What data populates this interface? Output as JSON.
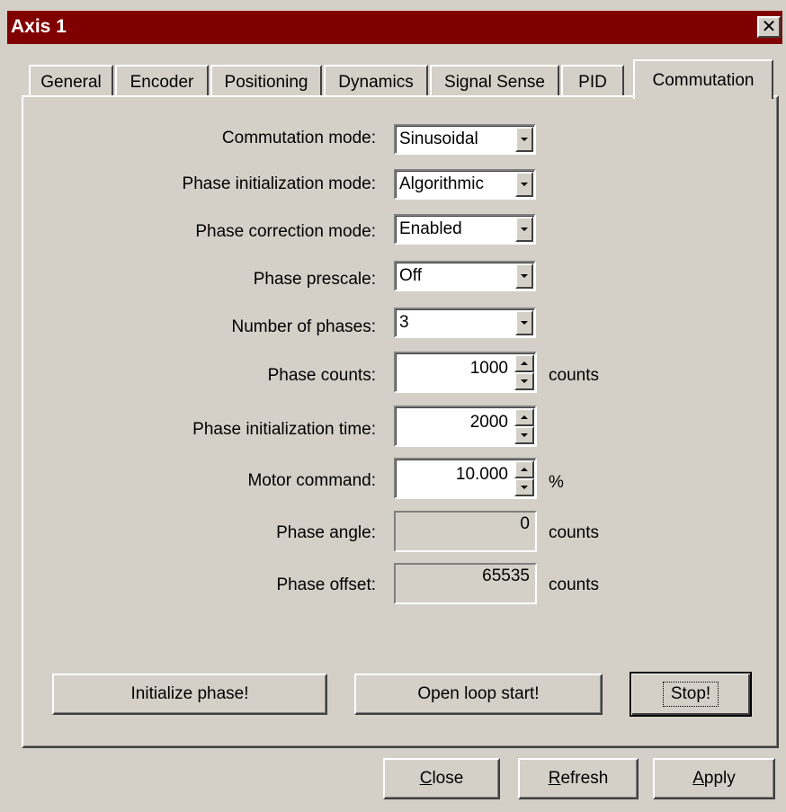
{
  "window": {
    "title": "Axis 1"
  },
  "tabs": [
    {
      "label": "General"
    },
    {
      "label": "Encoder"
    },
    {
      "label": "Positioning"
    },
    {
      "label": "Dynamics"
    },
    {
      "label": "Signal Sense"
    },
    {
      "label": "PID"
    },
    {
      "label": "Commutation",
      "active": true
    }
  ],
  "form": {
    "commutation_mode": {
      "label": "Commutation mode:",
      "value": "Sinusoidal"
    },
    "phase_init_mode": {
      "label": "Phase initialization mode:",
      "value": "Algorithmic"
    },
    "phase_correction_mode": {
      "label": "Phase correction mode:",
      "value": "Enabled"
    },
    "phase_prescale": {
      "label": "Phase prescale:",
      "value": "Off"
    },
    "number_of_phases": {
      "label": "Number of phases:",
      "value": "3"
    },
    "phase_counts": {
      "label": "Phase counts:",
      "value": "1000",
      "unit": "counts"
    },
    "phase_init_time": {
      "label": "Phase initialization time:",
      "value": "2000"
    },
    "motor_command": {
      "label": "Motor command:",
      "value": "10.000",
      "unit": "%"
    },
    "phase_angle": {
      "label": "Phase angle:",
      "value": "0",
      "unit": "counts"
    },
    "phase_offset": {
      "label": "Phase offset:",
      "value": "65535",
      "unit": "counts"
    }
  },
  "actions": {
    "initialize_phase": "Initialize phase!",
    "open_loop_start": "Open loop start!",
    "stop": "Stop!"
  },
  "footer": {
    "close_rest": "lose",
    "close_accel": "C",
    "refresh_accel": "R",
    "refresh_rest": "efresh",
    "apply_accel": "A",
    "apply_rest": "pply"
  },
  "icons": {
    "close": "close-icon",
    "dropdown": "chevron-down-icon",
    "spin_up": "chevron-up-icon",
    "spin_down": "chevron-down-icon"
  },
  "colors": {
    "titlebar": "#800000",
    "face": "#d4d0c8"
  }
}
